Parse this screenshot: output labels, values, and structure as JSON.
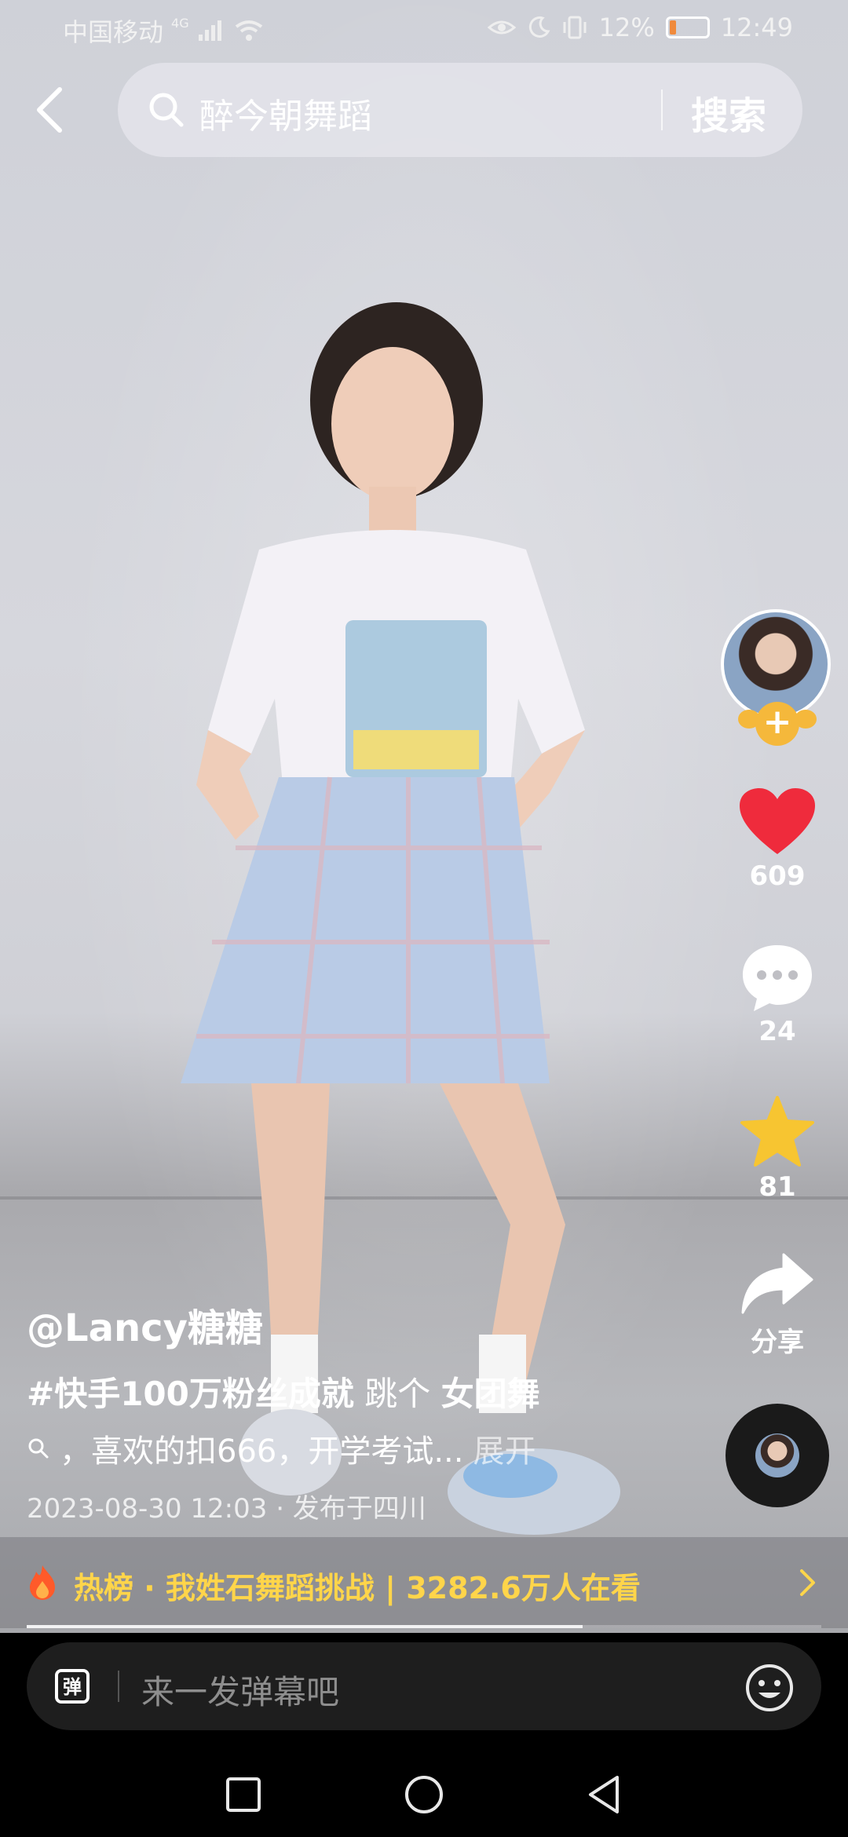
{
  "status_bar": {
    "carrier": "中国移动",
    "network": "4G",
    "battery": "12%",
    "time": "12:49"
  },
  "header": {
    "search_query": "醉今朝舞蹈",
    "search_button": "搜索"
  },
  "actions": {
    "likes": "609",
    "comments": "24",
    "favorites": "81",
    "share_label": "分享"
  },
  "post": {
    "author": "@Lancy糖糖",
    "hashtag": "#快手100万粉丝成就",
    "caption_middle": "跳个",
    "caption_bold": "女团舞",
    "description": "，喜欢的扣666，开学考试...",
    "expand_label": "展开",
    "meta": "2023-08-30 12:03 · 发布于四川"
  },
  "hot_banner": {
    "text": "热榜 · 我姓石舞蹈挑战 | 3282.6万人在看",
    "progress": 0.7
  },
  "comment_bar": {
    "danmaku_icon_label": "弹",
    "placeholder": "来一发弹幕吧"
  },
  "colors": {
    "like_red": "#ef2b3c",
    "star_gold": "#f7c531",
    "hot_yellow": "#ffd54a",
    "follow_orange": "#f5b83b"
  },
  "icons": [
    "back-arrow-icon",
    "search-icon",
    "heart-icon",
    "comment-bubble-icon",
    "star-icon",
    "share-arrow-icon",
    "music-disc-icon",
    "flame-icon",
    "chevron-right-icon",
    "danmaku-icon",
    "emoji-icon",
    "nav-square-icon",
    "nav-circle-icon",
    "nav-triangle-icon"
  ]
}
